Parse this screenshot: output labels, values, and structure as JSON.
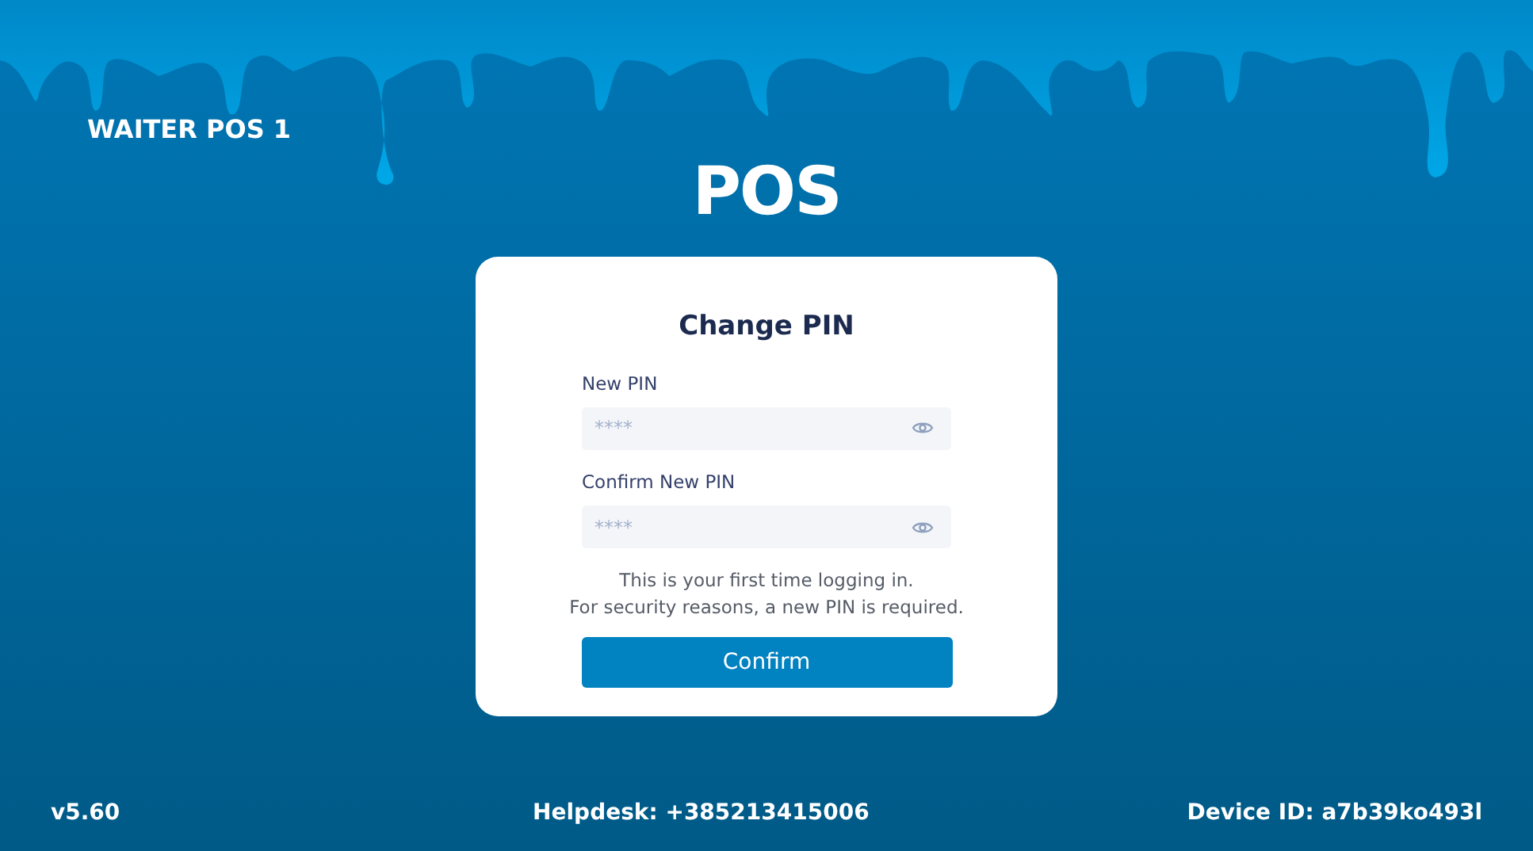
{
  "terminal_name": "WAITER POS 1",
  "logo": "POS",
  "dialog": {
    "title": "Change PIN",
    "fields": [
      {
        "label": "New PIN",
        "placeholder": "****"
      },
      {
        "label": "Confirm New PIN",
        "placeholder": "****"
      }
    ],
    "message_lines": [
      "This is your first time logging in.",
      "For security reasons, a new PIN is required."
    ],
    "button": "Confirm"
  },
  "footer": {
    "version": "v5.60",
    "helpdesk": "Helpdesk: +385213415006",
    "device_id": "Device ID: a7b39ko493l"
  }
}
